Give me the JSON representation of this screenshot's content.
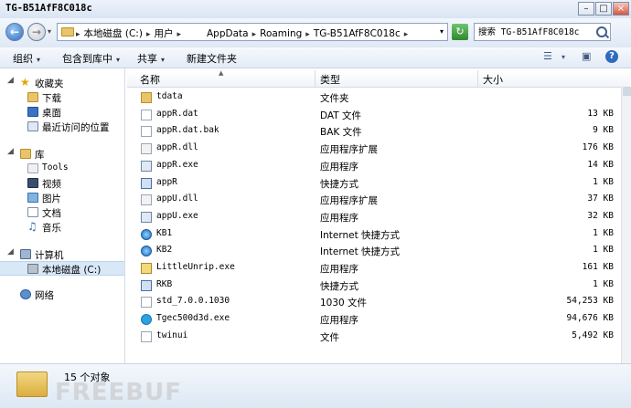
{
  "window": {
    "title": "TG-B51AfF8C018c"
  },
  "address": {
    "crumbs": [
      "本地磁盘 (C:)",
      "用户",
      "AppData",
      "Roaming",
      "TG-B51AfF8C018c"
    ]
  },
  "search": {
    "placeholder": "搜索 TG-B51AfF8C018c"
  },
  "toolbar": {
    "organize": "组织",
    "include": "包含到库中",
    "share": "共享",
    "new_folder": "新建文件夹"
  },
  "sidebar": {
    "favorites": "收藏夹",
    "downloads": "下载",
    "desktop": "桌面",
    "recent": "最近访问的位置",
    "libraries": "库",
    "tools": "Tools",
    "videos": "视频",
    "pictures": "图片",
    "documents": "文档",
    "music": "音乐",
    "computer": "计算机",
    "local_disk": "本地磁盘 (C:)",
    "network": "网络"
  },
  "columns": {
    "name": "名称",
    "type": "类型",
    "size": "大小"
  },
  "files": [
    {
      "name": "tdata",
      "type": "文件夹",
      "size": "",
      "icon": "folder-icon"
    },
    {
      "name": "appR.dat",
      "type": "DAT 文件",
      "size": "13 KB",
      "icon": "file-icon"
    },
    {
      "name": "appR.dat.bak",
      "type": "BAK 文件",
      "size": "9 KB",
      "icon": "file-icon"
    },
    {
      "name": "appR.dll",
      "type": "应用程序扩展",
      "size": "176 KB",
      "icon": "dll-icon"
    },
    {
      "name": "appR.exe",
      "type": "应用程序",
      "size": "14 KB",
      "icon": "exe-icon"
    },
    {
      "name": "appR",
      "type": "快捷方式",
      "size": "1 KB",
      "icon": "shortcut-icon"
    },
    {
      "name": "appU.dll",
      "type": "应用程序扩展",
      "size": "37 KB",
      "icon": "dll-icon"
    },
    {
      "name": "appU.exe",
      "type": "应用程序",
      "size": "32 KB",
      "icon": "exe-icon"
    },
    {
      "name": "KB1",
      "type": "Internet 快捷方式",
      "size": "1 KB",
      "icon": "internet-shortcut-icon"
    },
    {
      "name": "KB2",
      "type": "Internet 快捷方式",
      "size": "1 KB",
      "icon": "internet-shortcut-icon"
    },
    {
      "name": "LittleUnrip.exe",
      "type": "应用程序",
      "size": "161 KB",
      "icon": "archive-exe-icon"
    },
    {
      "name": "RKB",
      "type": "快捷方式",
      "size": "1 KB",
      "icon": "shortcut-icon"
    },
    {
      "name": "std_7.0.0.1030",
      "type": "1030 文件",
      "size": "54,253 KB",
      "icon": "file-icon"
    },
    {
      "name": "Tgec500d3d.exe",
      "type": "应用程序",
      "size": "94,676 KB",
      "icon": "telegram-icon"
    },
    {
      "name": "twinui",
      "type": "文件",
      "size": "5,492 KB",
      "icon": "file-icon"
    }
  ],
  "status": {
    "count": "15 个对象"
  },
  "watermark": {
    "text": "FREEBUF"
  }
}
